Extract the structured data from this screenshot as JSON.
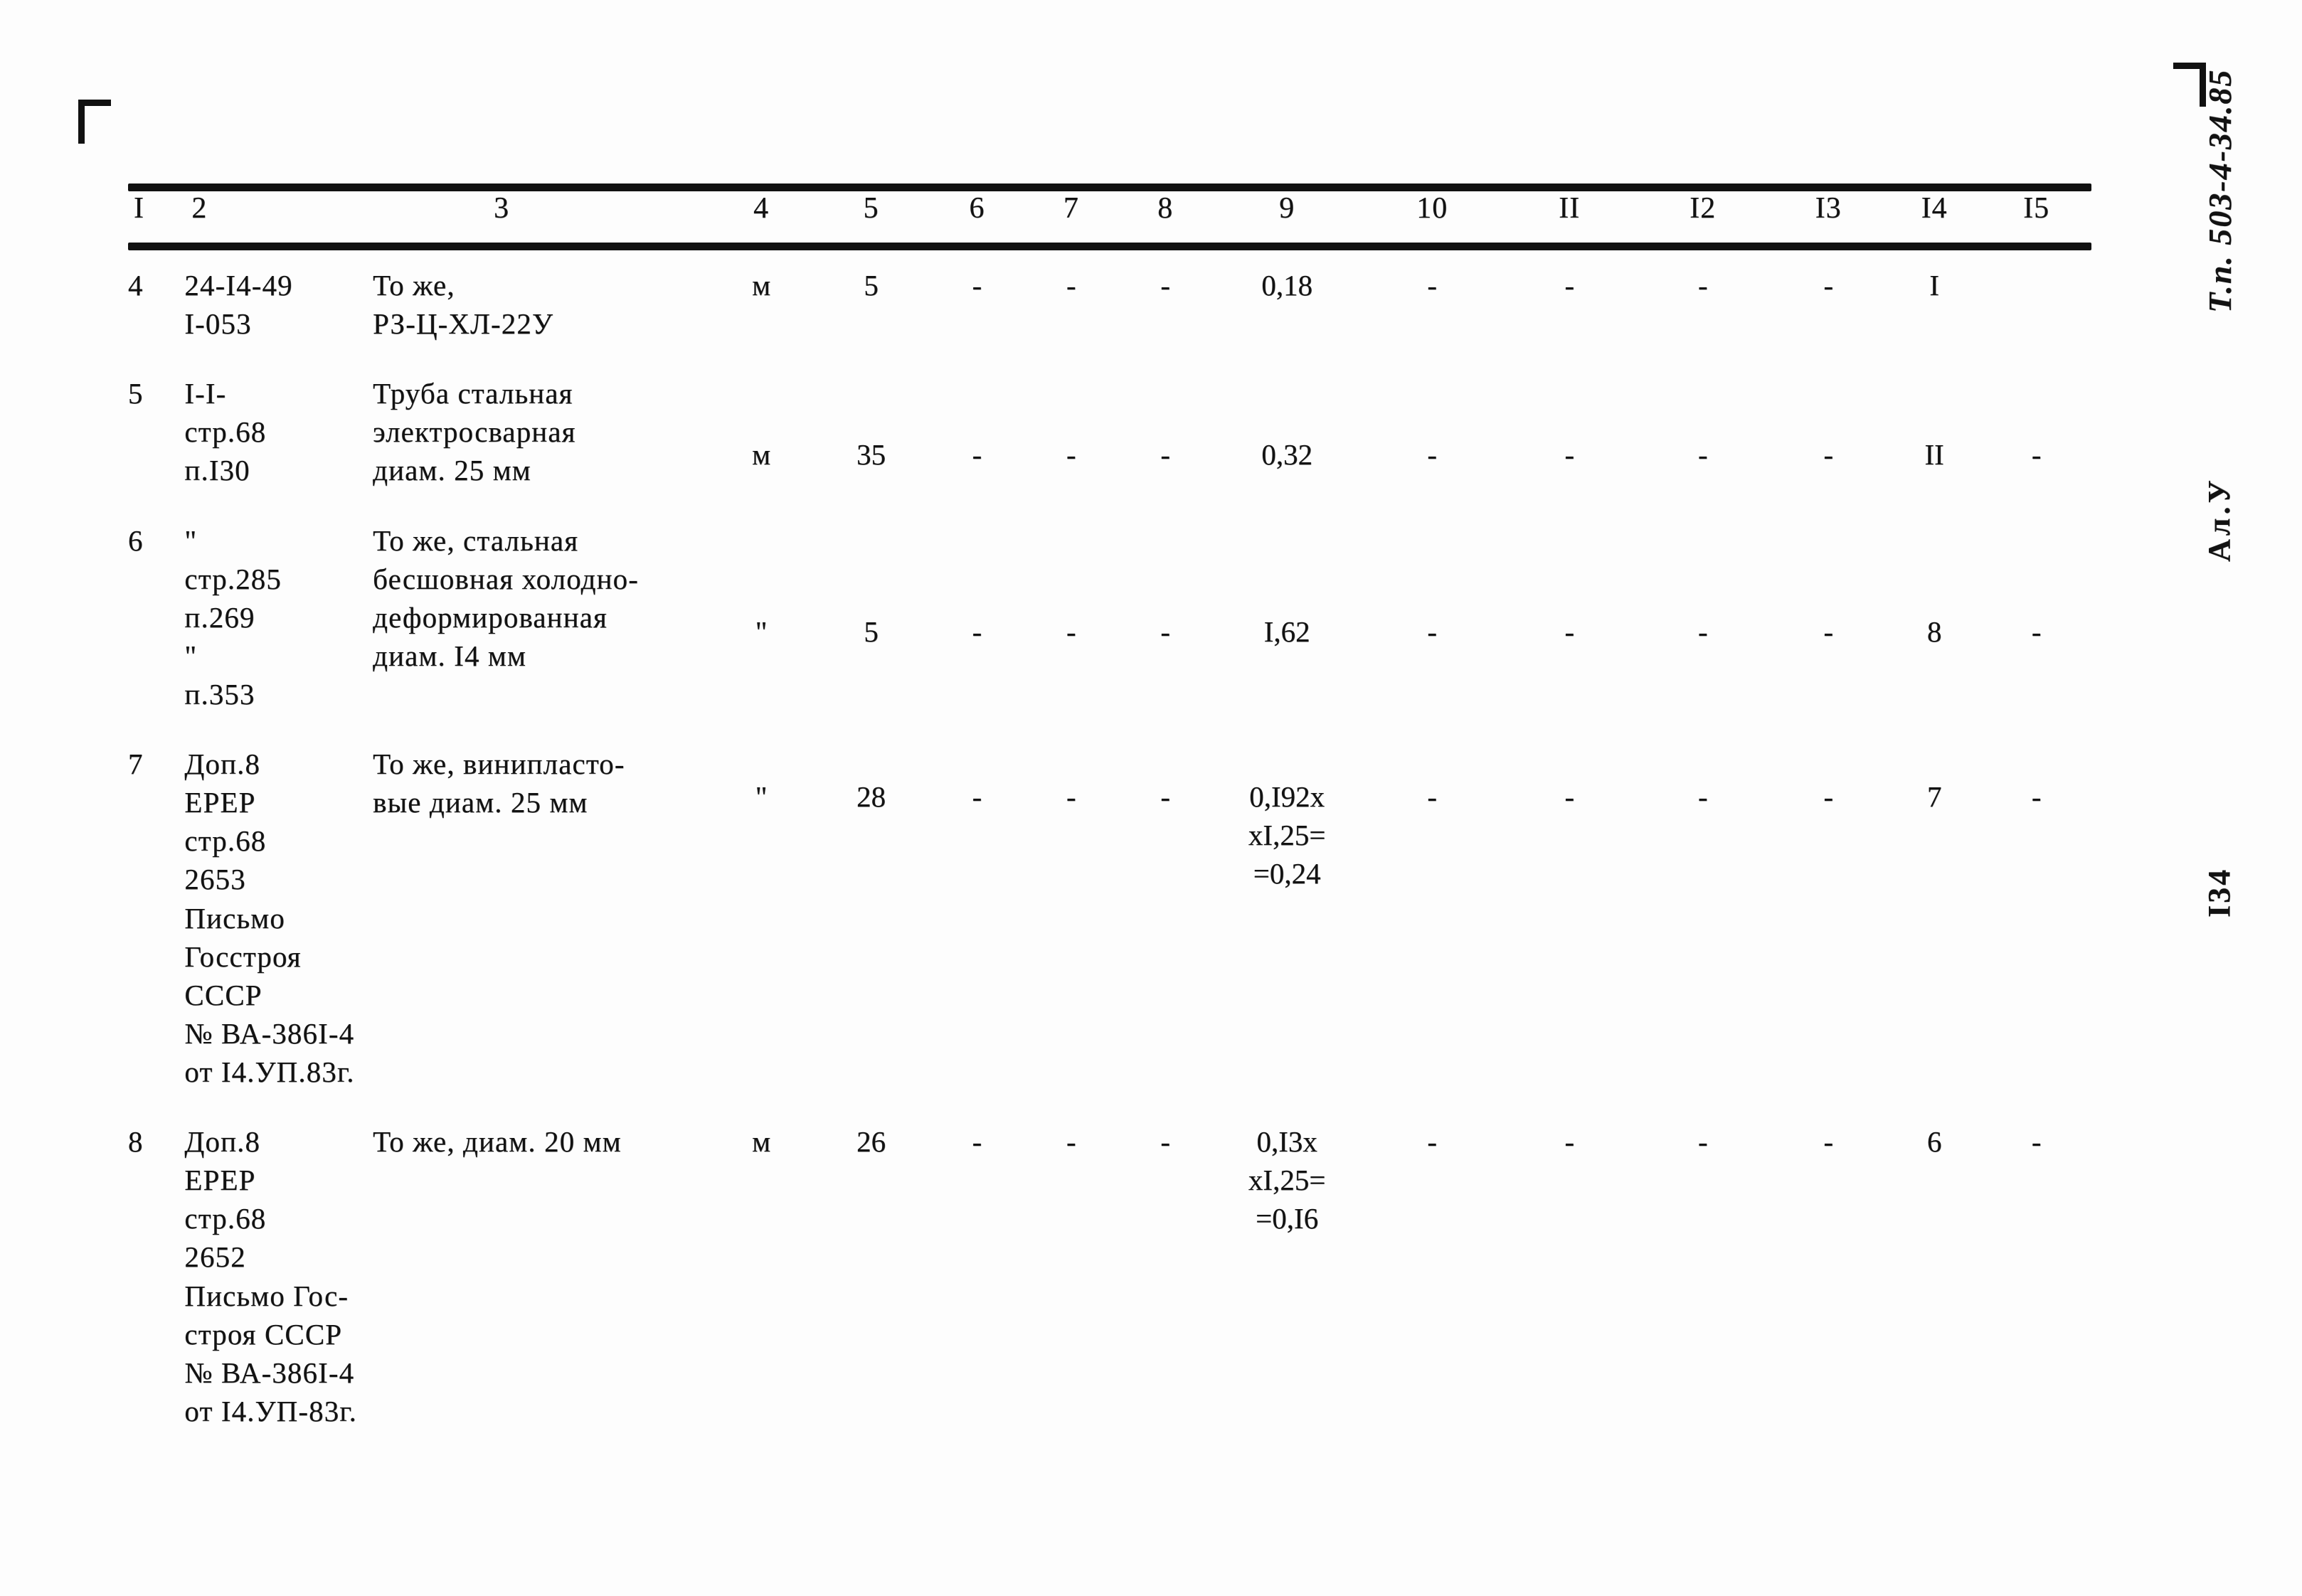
{
  "document": {
    "vertical_label_doc": "Т.п. 503-4-34.85",
    "vertical_label_album": "Ал.У",
    "vertical_label_page": "I34"
  },
  "table": {
    "headers": [
      "I",
      "2",
      "3",
      "4",
      "5",
      "6",
      "7",
      "8",
      "9",
      "10",
      "II",
      "I2",
      "I3",
      "I4",
      "I5"
    ],
    "rows": [
      {
        "pos": "4",
        "ref": "24-I4-49\nI-053",
        "name": "То же,\nРЗ-Ц-ХЛ-22У",
        "unit": "м",
        "c5": "5",
        "c6": "-",
        "c7": "-",
        "c8": "-",
        "c9": "0,18",
        "c10": "-",
        "c11": "-",
        "c12": "-",
        "c13": "-",
        "c14": "I",
        "c15": "",
        "c16": ""
      },
      {
        "pos": "5",
        "ref": "I-I-\nстр.68\nп.I30",
        "name": "Труба стальная\nэлектросварная\nдиам. 25 мм",
        "unit": "м",
        "c5": "35",
        "c6": "-",
        "c7": "-",
        "c8": "-",
        "c9": "0,32",
        "c10": "-",
        "c11": "-",
        "c12": "-",
        "c13": "-",
        "c14": "II",
        "c15": "-",
        "c16": "-"
      },
      {
        "pos": "6",
        "ref": "\"\nстр.285\nп.269\n\"\nп.353",
        "name": "То же, стальная\nбесшовная холодно-\nдеформированная\nдиам. I4 мм",
        "unit": "\"",
        "c5": "5",
        "c6": "-",
        "c7": "-",
        "c8": "-",
        "c9": "I,62",
        "c10": "-",
        "c11": "-",
        "c12": "-",
        "c13": "-",
        "c14": "8",
        "c15": "-",
        "c16": "-"
      },
      {
        "pos": "7",
        "ref": "Доп.8\nЕРЕР\nстр.68\n2653\nПисьмо\nГосстроя\nСССР\n№ ВА-386I-4\nот I4.УП.83г.",
        "name": "То же, винипласто-\nвые диам. 25 мм",
        "unit": "\"",
        "c5": "28",
        "c6": "-",
        "c7": "-",
        "c8": "-",
        "c9": "0,I92х\nхI,25=\n=0,24",
        "c10": "-",
        "c11": "-",
        "c12": "-",
        "c13": "-",
        "c14": "7",
        "c15": "-",
        "c16": "-"
      },
      {
        "pos": "8",
        "ref": "Доп.8\nЕРЕР\nстр.68\n2652\nПисьмо Гос-\nстроя СССР\n№ ВА-386I-4\nот I4.УП-83г.",
        "name": "То же, диам. 20 мм",
        "unit": "м",
        "c5": "26",
        "c6": "-",
        "c7": "-",
        "c8": "-",
        "c9": "0,I3х\nхI,25=\n=0,I6",
        "c10": "-",
        "c11": "-",
        "c12": "-",
        "c13": "-",
        "c14": "6",
        "c15": "-",
        "c16": "-"
      }
    ]
  }
}
